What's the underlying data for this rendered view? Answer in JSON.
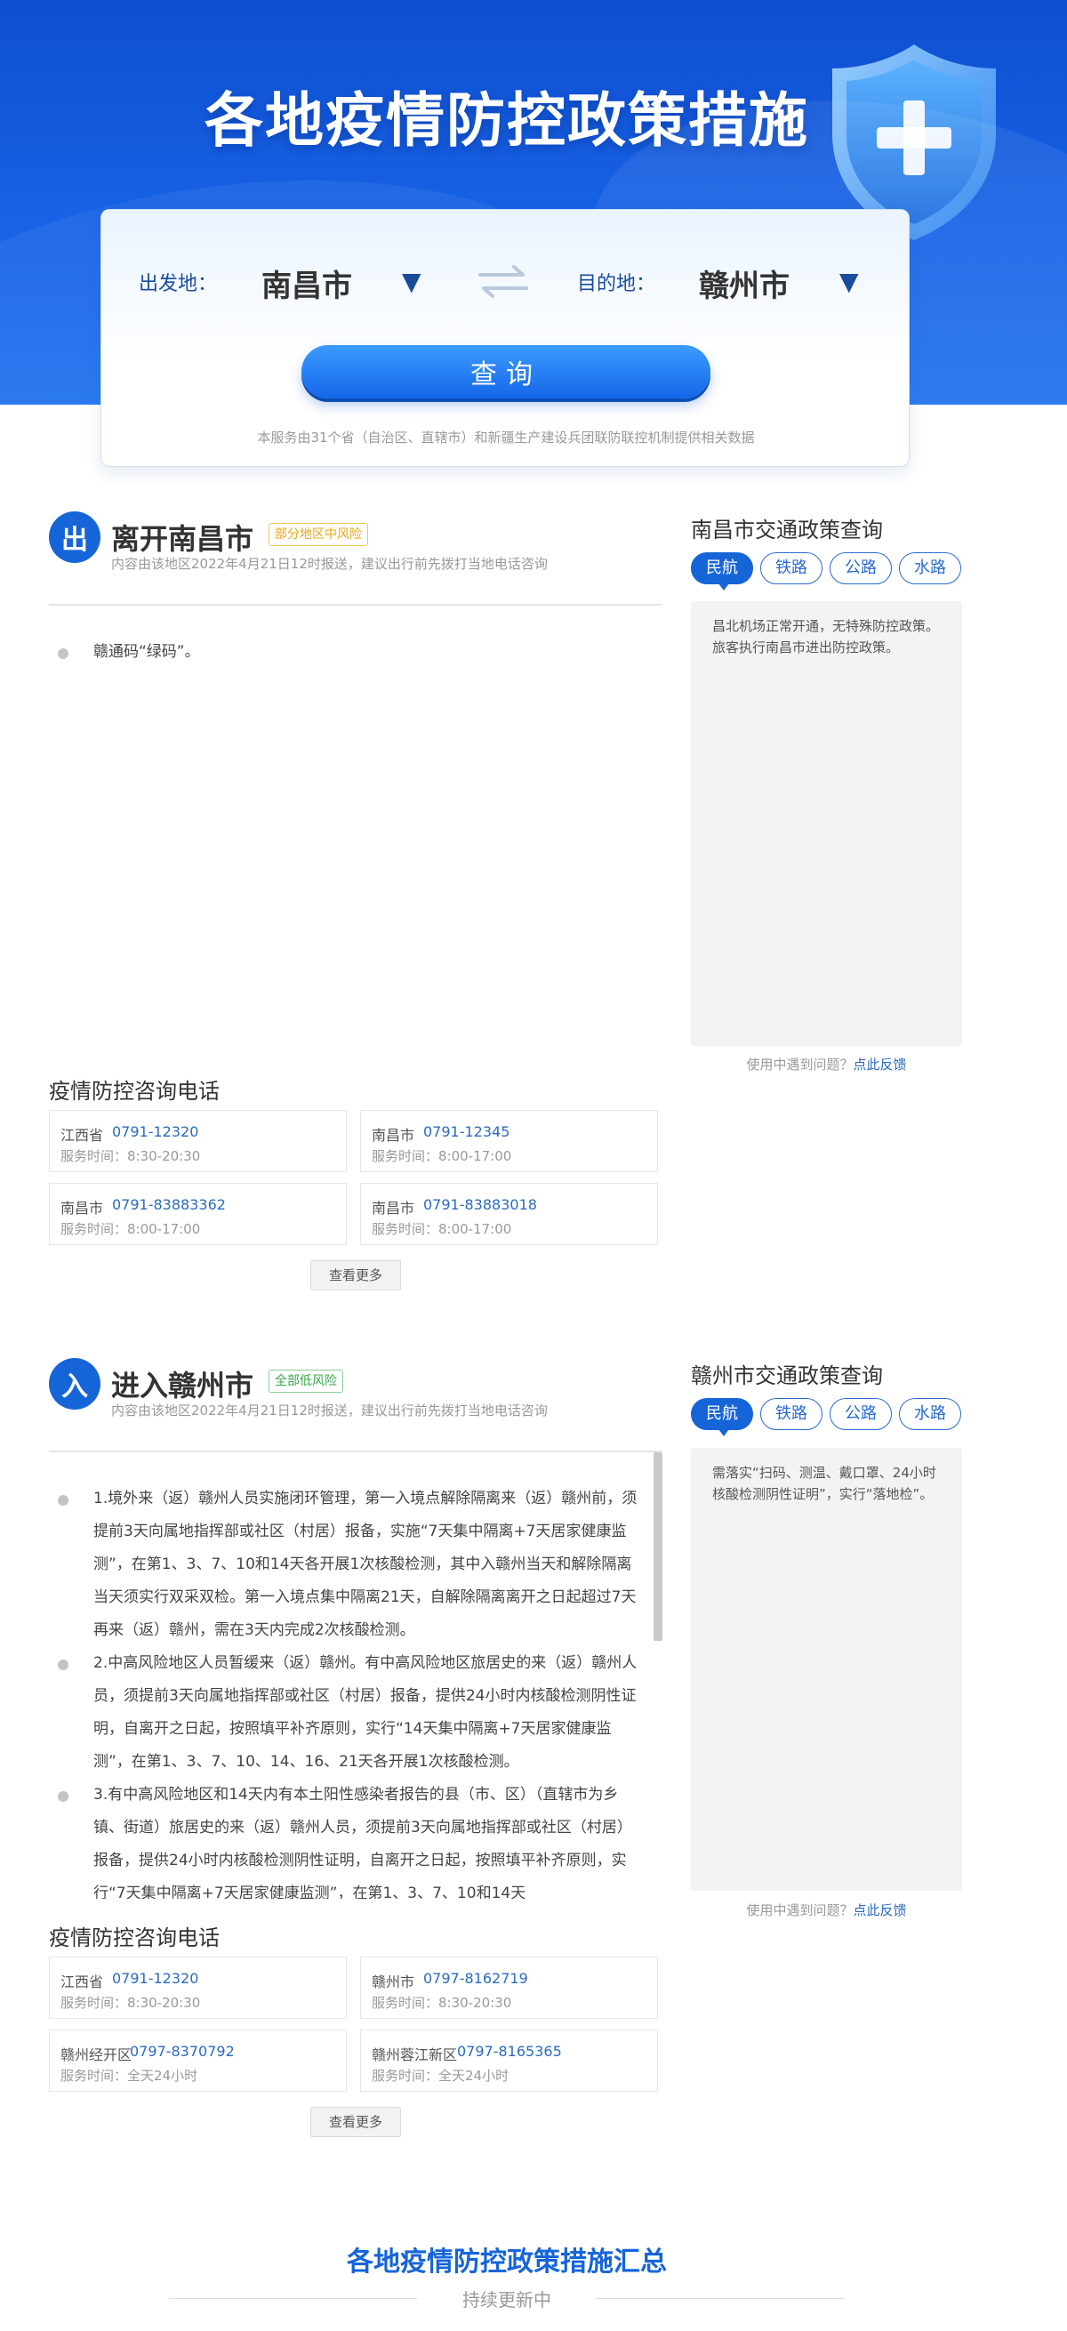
{
  "banner": {
    "title": "各地疫情防控政策措施"
  },
  "search": {
    "from_label": "出发地：",
    "from_city": "南昌市",
    "to_label": "目的地：",
    "to_city": "赣州市",
    "query_label": "查询",
    "note": "本服务由31个省（自治区、直辖市）和新疆生产建设兵团联防联控机制提供相关数据"
  },
  "leave": {
    "icon_char": "出",
    "title": "离开南昌市",
    "risk": "部分地区中风险",
    "subtitle": "内容由该地区2022年4月21日12时报送，建议出行前先拨打当地电话咨询",
    "policies": [
      "赣通码“绿码”。"
    ],
    "phone_title": "疫情防控咨询电话",
    "phones": [
      {
        "region": "江西省",
        "number": "0791-12320",
        "hours": "服务时间：8:30-20:30"
      },
      {
        "region": "南昌市",
        "number": "0791-12345",
        "hours": "服务时间：8:00-17:00"
      },
      {
        "region": "南昌市",
        "number": "0791-83883362",
        "hours": "服务时间：8:00-17:00"
      },
      {
        "region": "南昌市",
        "number": "0791-83883018",
        "hours": "服务时间：8:00-17:00"
      }
    ],
    "more_label": "查看更多",
    "side_title": "南昌市交通政策查询",
    "tabs": [
      "民航",
      "铁路",
      "公路",
      "水路"
    ],
    "side_text": "昌北机场正常开通，无特殊防控政策。旅客执行南昌市进出防控政策。",
    "feedback_text": "使用中遇到问题？",
    "feedback_link": "点此反馈"
  },
  "enter": {
    "icon_char": "入",
    "title": "进入赣州市",
    "risk": "全部低风险",
    "subtitle": "内容由该地区2022年4月21日12时报送，建议出行前先拨打当地电话咨询",
    "policies": [
      "1.境外来（返）赣州人员实施闭环管理，第一入境点解除隔离来（返）赣州前，须提前3天向属地指挥部或社区（村居）报备，实施“7天集中隔离+7天居家健康监测”，在第1、3、7、10和14天各开展1次核酸检测，其中入赣州当天和解除隔离当天须实行双采双检。第一入境点集中隔离21天，自解除隔离离开之日起超过7天再来（返）赣州，需在3天内完成2次核酸检测。",
      "2.中高风险地区人员暂缓来（返）赣州。有中高风险地区旅居史的来（返）赣州人员，须提前3天向属地指挥部或社区（村居）报备，提供24小时内核酸检测阴性证明，自离开之日起，按照填平补齐原则，实行“14天集中隔离+7天居家健康监测”，在第1、3、7、10、14、16、21天各开展1次核酸检测。",
      "3.有中高风险地区和14天内有本土阳性感染者报告的县（市、区）（直辖市为乡镇、街道）旅居史的来（返）赣州人员，须提前3天向属地指挥部或社区（村居）报备，提供24小时内核酸检测阴性证明，自离开之日起，按照填平补齐原则，实行“7天集中隔离+7天居家健康监测”，在第1、3、7、10和14天"
    ],
    "phone_title": "疫情防控咨询电话",
    "phones": [
      {
        "region": "江西省",
        "number": "0791-12320",
        "hours": "服务时间：8:30-20:30"
      },
      {
        "region": "赣州市",
        "number": "0797-8162719",
        "hours": "服务时间：8:30-20:30"
      },
      {
        "region": "赣州经开区",
        "number": "0797-8370792",
        "hours": "服务时间：全天24小时"
      },
      {
        "region": "赣州蓉江新区",
        "number": "0797-8165365",
        "hours": "服务时间：全天24小时"
      }
    ],
    "more_label": "查看更多",
    "side_title": "赣州市交通政策查询",
    "tabs": [
      "民航",
      "铁路",
      "公路",
      "水路"
    ],
    "side_text": "需落实“扫码、测温、戴口罩、24小时核酸检测阴性证明”，实行“落地检”。",
    "feedback_text": "使用中遇到问题？",
    "feedback_link": "点此反馈"
  },
  "footer": {
    "title": "各地疫情防控政策措施汇总",
    "subtitle": "持续更新中"
  },
  "colors": {
    "brand_blue": "#1665d8",
    "risk_mid": "#e6a817",
    "risk_low": "#3aa84f",
    "link": "#2a6bc0"
  }
}
